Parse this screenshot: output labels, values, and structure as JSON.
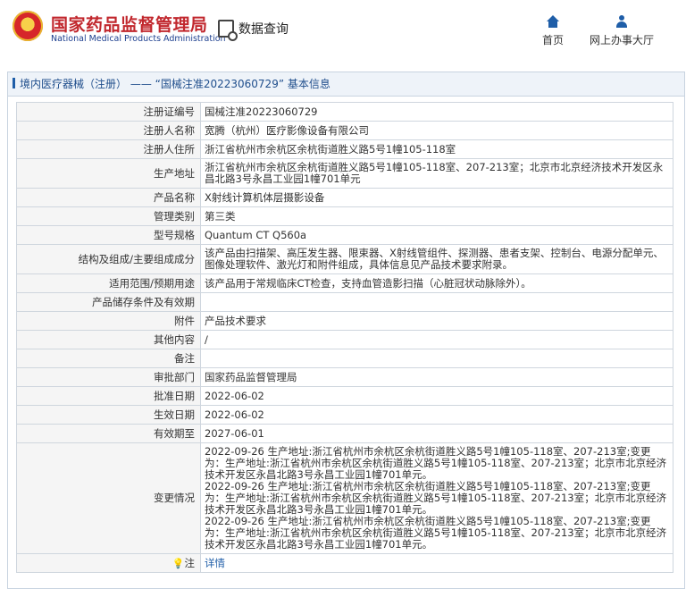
{
  "header": {
    "logo_cn": "国家药品监督管理局",
    "logo_en": "National Medical Products Administration",
    "query_label": "数据查询",
    "nav": [
      {
        "label": "首页",
        "icon": "home-icon"
      },
      {
        "label": "网上办事大厅",
        "icon": "user-icon"
      }
    ]
  },
  "panel": {
    "title": "境内医疗器械（注册） —— “国械注准20223060729” 基本信息"
  },
  "rows": [
    {
      "key": "注册证编号",
      "value": "国械注准20223060729"
    },
    {
      "key": "注册人名称",
      "value": "宽腾（杭州）医疗影像设备有限公司"
    },
    {
      "key": "注册人住所",
      "value": "浙江省杭州市余杭区余杭街道胜义路5号1幢105-118室"
    },
    {
      "key": "生产地址",
      "value": "浙江省杭州市余杭区余杭街道胜义路5号1幢105-118室、207-213室；北京市北京经济技术开发区永昌北路3号永昌工业园1幢701单元"
    },
    {
      "key": "产品名称",
      "value": "X射线计算机体层摄影设备"
    },
    {
      "key": "管理类别",
      "value": "第三类"
    },
    {
      "key": "型号规格",
      "value": "Quantum CT Q560a"
    },
    {
      "key": "结构及组成/主要组成成分",
      "value": "该产品由扫描架、高压发生器、限束器、X射线管组件、探测器、患者支架、控制台、电源分配单元、图像处理软件、激光灯和附件组成，具体信息见产品技术要求附录。"
    },
    {
      "key": "适用范围/预期用途",
      "value": "该产品用于常规临床CT检查，支持血管造影扫描（心脏冠状动脉除外）。"
    },
    {
      "key": "产品储存条件及有效期",
      "value": ""
    },
    {
      "key": "附件",
      "value": "产品技术要求"
    },
    {
      "key": "其他内容",
      "value": "/"
    },
    {
      "key": "备注",
      "value": ""
    },
    {
      "key": "审批部门",
      "value": "国家药品监督管理局"
    },
    {
      "key": "批准日期",
      "value": "2022-06-02"
    },
    {
      "key": "生效日期",
      "value": "2022-06-02"
    },
    {
      "key": "有效期至",
      "value": "2027-06-01"
    }
  ],
  "changes": {
    "key": "变更情况",
    "entries": [
      "2022-09-26 生产地址:浙江省杭州市余杭区余杭街道胜义路5号1幢105-118室、207-213室;变更为：生产地址:浙江省杭州市余杭区余杭街道胜义路5号1幢105-118室、207-213室；北京市北京经济技术开发区永昌北路3号永昌工业园1幢701单元。",
      "2022-09-26 生产地址:浙江省杭州市余杭区余杭街道胜义路5号1幢105-118室、207-213室;变更为：生产地址:浙江省杭州市余杭区余杭街道胜义路5号1幢105-118室、207-213室；北京市北京经济技术开发区永昌北路3号永昌工业园1幢701单元。",
      "2022-09-26 生产地址:浙江省杭州市余杭区余杭街道胜义路5号1幢105-118室、207-213室;变更为：生产地址:浙江省杭州市余杭区余杭街道胜义路5号1幢105-118室、207-213室；北京市北京经济技术开发区永昌北路3号永昌工业园1幢701单元。"
    ]
  },
  "note": {
    "key": "注",
    "icon": "bulb-icon",
    "link_label": "详情"
  }
}
